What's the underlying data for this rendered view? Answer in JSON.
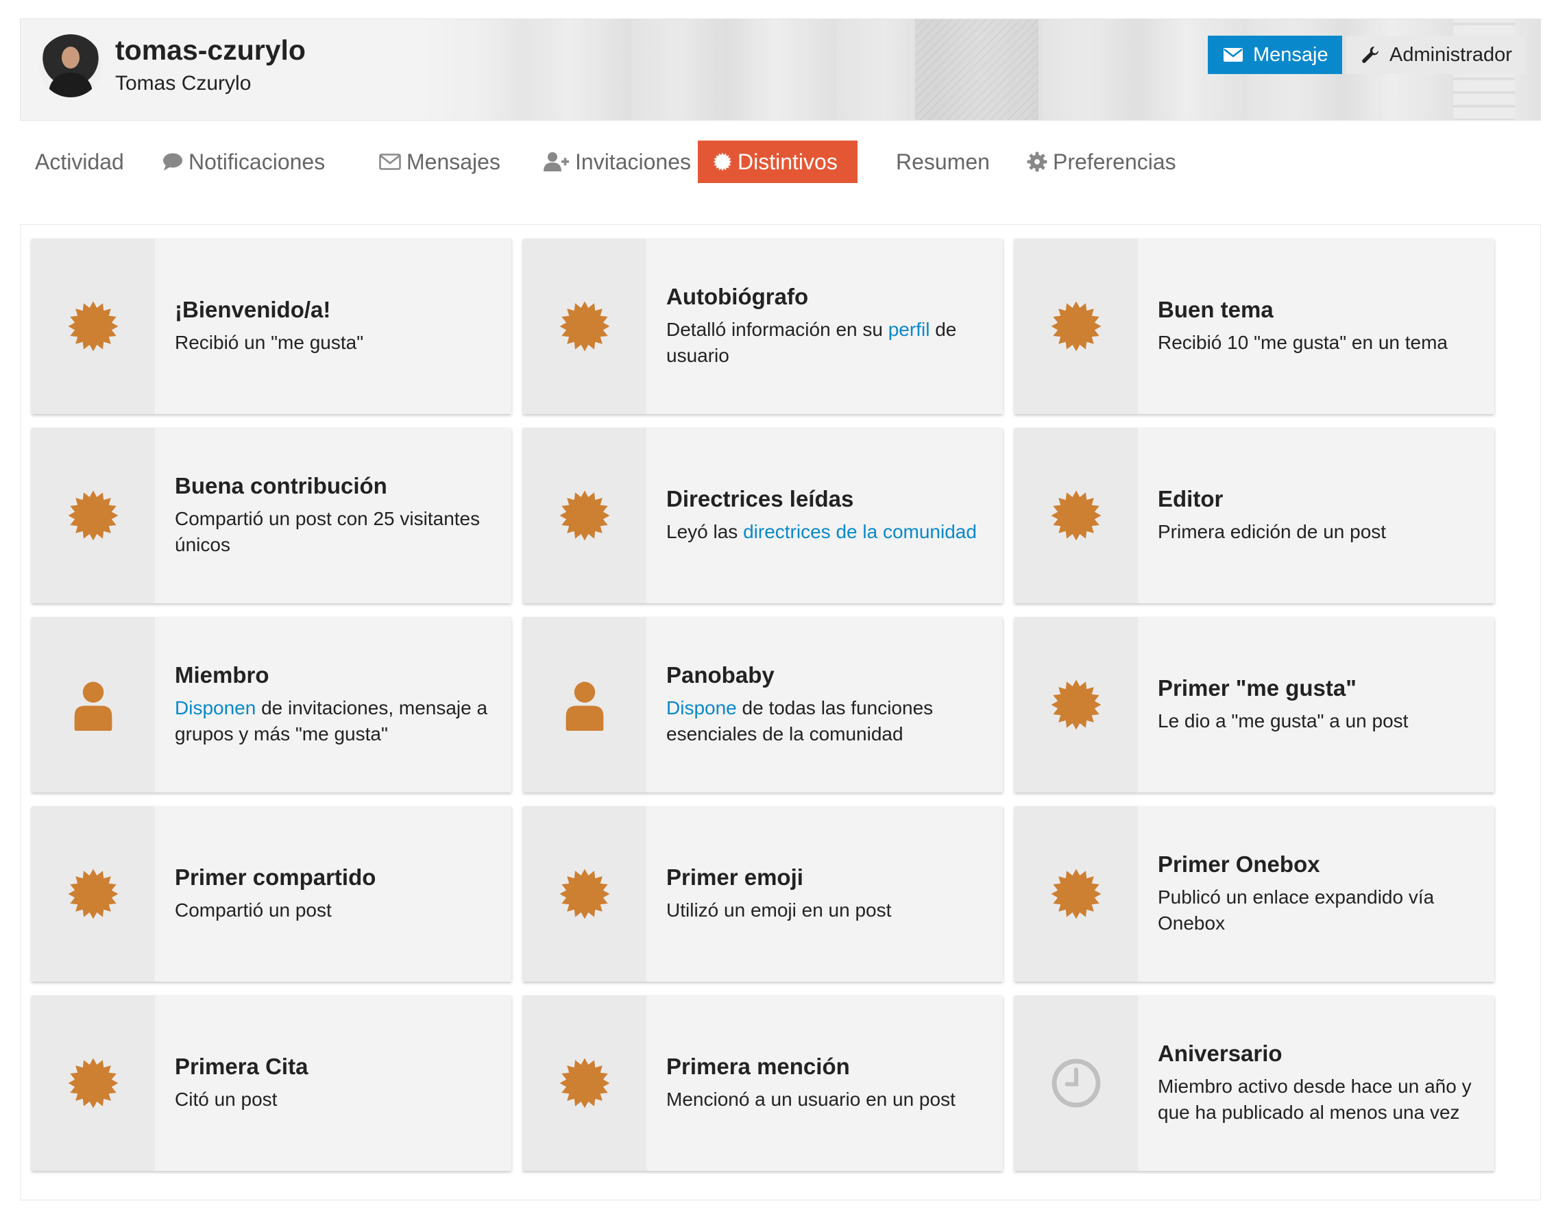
{
  "header": {
    "username": "tomas-czurylo",
    "full_name": "Tomas Czurylo",
    "message_button": "Mensaje",
    "admin_button": "Administrador"
  },
  "nav": {
    "items": [
      {
        "label": "Actividad",
        "icon": ""
      },
      {
        "label": "Notificaciones",
        "icon": "comment-icon"
      },
      {
        "label": "Mensajes",
        "icon": "envelope-icon"
      },
      {
        "label": "Invitaciones",
        "icon": "user-plus-icon"
      },
      {
        "label": "Distintivos",
        "icon": "badge-icon",
        "active": true
      },
      {
        "label": "Resumen",
        "icon": ""
      },
      {
        "label": "Preferencias",
        "icon": "gear-icon"
      }
    ]
  },
  "colors": {
    "accent_red": "#e45735",
    "primary_blue": "#0a88cc",
    "badge_orange": "#cd7f32",
    "badge_gray": "#c0c0c0"
  },
  "badges": [
    {
      "icon": "certificate-icon",
      "title": "¡Bienvenido/a!",
      "pre": "Recibió un \"me gusta\"",
      "link": "",
      "post": ""
    },
    {
      "icon": "certificate-icon",
      "title": "Autobiógrafo",
      "pre": "Detalló información en su ",
      "link": "perfil",
      "post": " de usuario"
    },
    {
      "icon": "certificate-icon",
      "title": "Buen tema",
      "pre": "Recibió 10 \"me gusta\" en un tema",
      "link": "",
      "post": ""
    },
    {
      "icon": "certificate-icon",
      "title": "Buena contribución",
      "pre": "Compartió un post con 25 visitantes únicos",
      "link": "",
      "post": ""
    },
    {
      "icon": "certificate-icon",
      "title": "Directrices leídas",
      "pre": "Leyó las ",
      "link": "directrices de la comunidad",
      "post": ""
    },
    {
      "icon": "certificate-icon",
      "title": "Editor",
      "pre": "Primera edición de un post",
      "link": "",
      "post": ""
    },
    {
      "icon": "user-icon",
      "title": "Miembro",
      "pre": "",
      "link": "Disponen",
      "post": " de invitaciones, mensaje a grupos y más \"me gusta\""
    },
    {
      "icon": "user-icon",
      "title": "Panobaby",
      "pre": "",
      "link": "Dispone",
      "post": " de todas las funciones esenciales de la comunidad"
    },
    {
      "icon": "certificate-icon",
      "title": "Primer \"me gusta\"",
      "pre": "Le dio a \"me gusta\" a un post",
      "link": "",
      "post": ""
    },
    {
      "icon": "certificate-icon",
      "title": "Primer compartido",
      "pre": "Compartió un post",
      "link": "",
      "post": ""
    },
    {
      "icon": "certificate-icon",
      "title": "Primer emoji",
      "pre": "Utilizó un emoji en un post",
      "link": "",
      "post": ""
    },
    {
      "icon": "certificate-icon",
      "title": "Primer Onebox",
      "pre": "Publicó un enlace expandido vía Onebox",
      "link": "",
      "post": ""
    },
    {
      "icon": "certificate-icon",
      "title": "Primera Cita",
      "pre": "Citó un post",
      "link": "",
      "post": ""
    },
    {
      "icon": "certificate-icon",
      "title": "Primera mención",
      "pre": "Mencionó a un usuario en un post",
      "link": "",
      "post": ""
    },
    {
      "icon": "clock-icon",
      "title": "Aniversario",
      "pre": "Miembro activo desde hace un año y que ha publicado al menos una vez",
      "link": "",
      "post": ""
    }
  ]
}
